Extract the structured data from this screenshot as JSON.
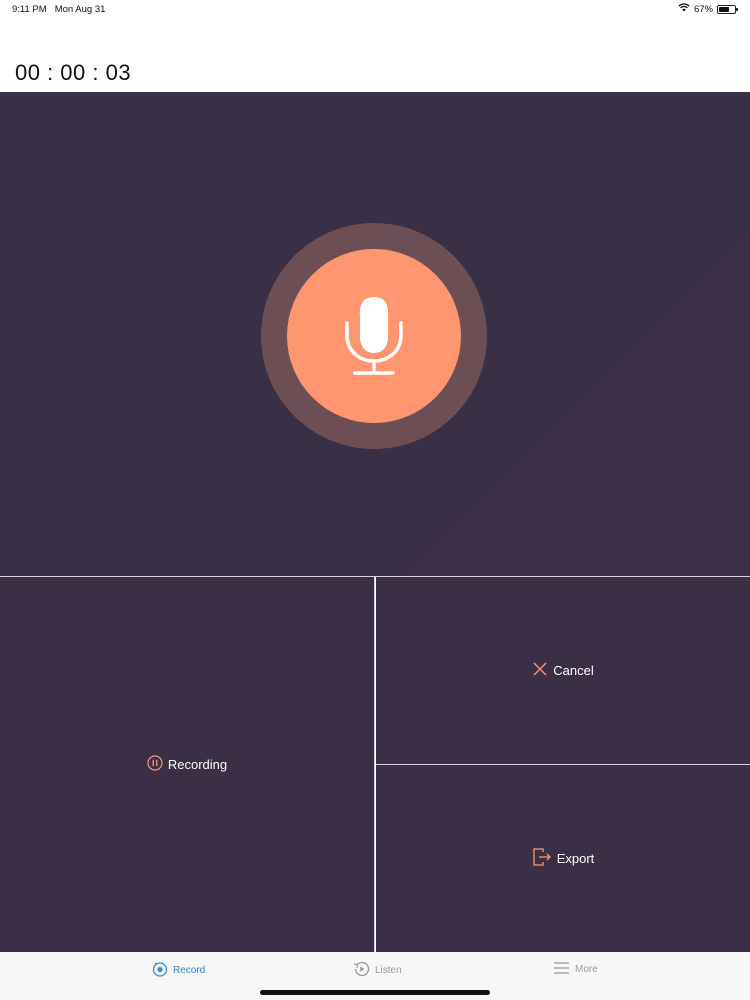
{
  "status_bar": {
    "time": "9:11 PM",
    "date": "Mon Aug 31",
    "battery_percent": "67%",
    "battery_level": 0.67
  },
  "timer": {
    "elapsed": "00 : 00 : 03"
  },
  "controls": {
    "recording_label": "Recording",
    "cancel_label": "Cancel",
    "export_label": "Export"
  },
  "tabs": [
    {
      "label": "Record",
      "icon": "record-tab-icon",
      "active": true
    },
    {
      "label": "Listen",
      "icon": "listen-tab-icon",
      "active": false
    },
    {
      "label": "More",
      "icon": "menu-icon",
      "active": false
    }
  ],
  "colors": {
    "accent": "#ff9670",
    "panel_background": "#3a2f44",
    "active_tab": "#2f8ad6",
    "inactive_tab": "#9a9a9e"
  }
}
